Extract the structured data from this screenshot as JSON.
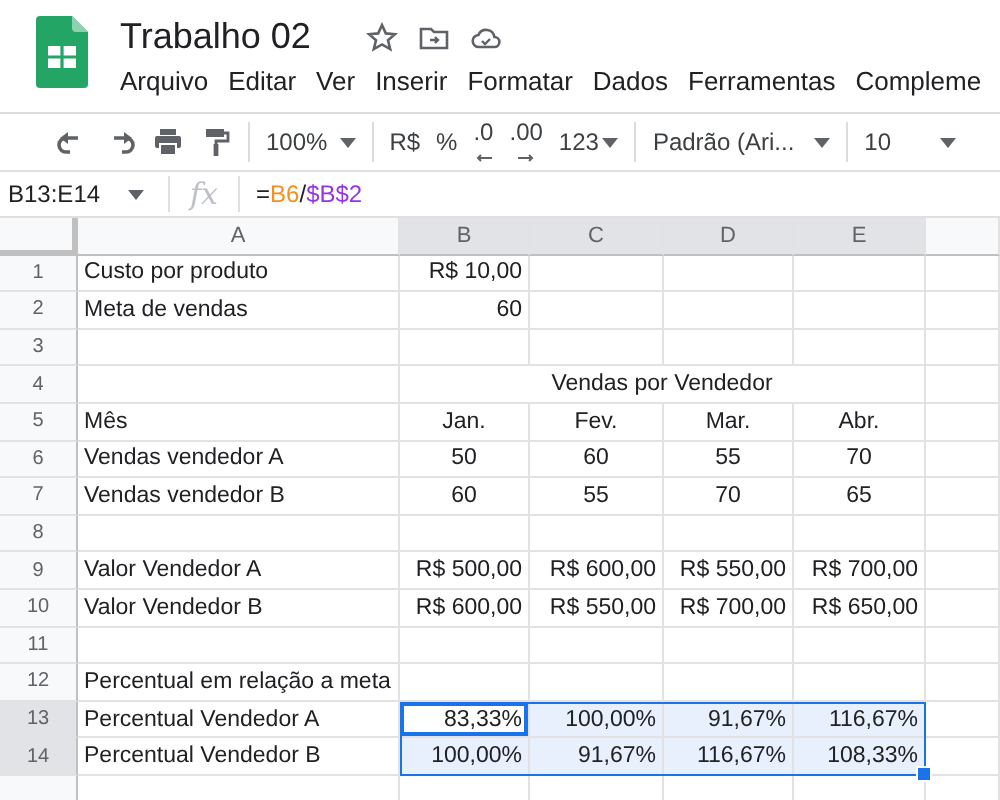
{
  "document": {
    "title": "Trabalho 02"
  },
  "menu": [
    "Arquivo",
    "Editar",
    "Ver",
    "Inserir",
    "Formatar",
    "Dados",
    "Ferramentas",
    "Compleme"
  ],
  "toolbar": {
    "zoom": "100%",
    "currency": "R$",
    "percent": "%",
    "decrease_decimals": ".0",
    "increase_decimals": ".00",
    "more_formats": "123",
    "font": "Padrão (Ari...",
    "font_size": "10"
  },
  "formula_bar": {
    "name_box": "B13:E14",
    "fx": "fx",
    "formula": [
      {
        "text": "=",
        "color": "#202124"
      },
      {
        "text": "B6",
        "color": "#f4901f"
      },
      {
        "text": "/",
        "color": "#202124"
      },
      {
        "text": "$B$2",
        "color": "#9334e6"
      }
    ]
  },
  "columns": [
    {
      "label": "A",
      "selected": false
    },
    {
      "label": "B",
      "selected": true
    },
    {
      "label": "C",
      "selected": true
    },
    {
      "label": "D",
      "selected": true
    },
    {
      "label": "E",
      "selected": true
    }
  ],
  "rows": [
    {
      "num": "1",
      "kind": "setting",
      "selected": false,
      "cells": {
        "A": {
          "text": "Custo por produto",
          "active": false
        },
        "B": {
          "text": "R$ 10,00",
          "active": false
        }
      }
    },
    {
      "num": "2",
      "kind": "setting",
      "selected": false,
      "cells": {
        "A": {
          "text": "Meta de vendas",
          "active": false
        },
        "B": {
          "text": "60",
          "active": false
        }
      }
    },
    {
      "num": "3",
      "kind": "blank",
      "selected": false,
      "cells": {}
    },
    {
      "num": "4",
      "kind": "title",
      "selected": false,
      "cells": {
        "B": {
          "text": "Vendas por Vendedor",
          "active": false
        }
      }
    },
    {
      "num": "5",
      "kind": "count",
      "selected": false,
      "cells": {
        "A": {
          "text": "Mês",
          "active": false
        },
        "B": {
          "text": "Jan.",
          "active": false
        },
        "C": {
          "text": "Fev.",
          "active": false
        },
        "D": {
          "text": "Mar.",
          "active": false
        },
        "E": {
          "text": "Abr.",
          "active": false
        }
      }
    },
    {
      "num": "6",
      "kind": "count",
      "selected": false,
      "cells": {
        "A": {
          "text": "Vendas vendedor A",
          "active": false
        },
        "B": {
          "text": "50",
          "active": false
        },
        "C": {
          "text": "60",
          "active": false
        },
        "D": {
          "text": "55",
          "active": false
        },
        "E": {
          "text": "70",
          "active": false
        }
      }
    },
    {
      "num": "7",
      "kind": "count",
      "selected": false,
      "cells": {
        "A": {
          "text": "Vendas vendedor B",
          "active": false
        },
        "B": {
          "text": "60",
          "active": false
        },
        "C": {
          "text": "55",
          "active": false
        },
        "D": {
          "text": "70",
          "active": false
        },
        "E": {
          "text": "65",
          "active": false
        }
      }
    },
    {
      "num": "8",
      "kind": "blank",
      "selected": false,
      "cells": {}
    },
    {
      "num": "9",
      "kind": "amount",
      "selected": false,
      "cells": {
        "A": {
          "text": "Valor Vendedor A",
          "active": false
        },
        "B": {
          "text": "R$ 500,00",
          "active": false
        },
        "C": {
          "text": "R$ 600,00",
          "active": false
        },
        "D": {
          "text": "R$ 550,00",
          "active": false
        },
        "E": {
          "text": "R$ 700,00",
          "active": false
        }
      }
    },
    {
      "num": "10",
      "kind": "amount",
      "selected": false,
      "cells": {
        "A": {
          "text": "Valor Vendedor B",
          "active": false
        },
        "B": {
          "text": "R$ 600,00",
          "active": false
        },
        "C": {
          "text": "R$ 550,00",
          "active": false
        },
        "D": {
          "text": "R$ 700,00",
          "active": false
        },
        "E": {
          "text": "R$ 650,00",
          "active": false
        }
      }
    },
    {
      "num": "11",
      "kind": "blank",
      "selected": false,
      "cells": {}
    },
    {
      "num": "12",
      "kind": "amount",
      "selected": false,
      "cells": {
        "A": {
          "text": "Percentual em relação a meta",
          "active": false
        }
      }
    },
    {
      "num": "13",
      "kind": "amount",
      "selected": true,
      "cells": {
        "A": {
          "text": "Percentual Vendedor A",
          "active": false
        },
        "B": {
          "text": "83,33%",
          "active": true
        },
        "C": {
          "text": "100,00%",
          "active": false
        },
        "D": {
          "text": "91,67%",
          "active": false
        },
        "E": {
          "text": "116,67%",
          "active": false
        }
      }
    },
    {
      "num": "14",
      "kind": "amount",
      "selected": true,
      "cells": {
        "A": {
          "text": "Percentual Vendedor B",
          "active": false
        },
        "B": {
          "text": "100,00%",
          "active": false
        },
        "C": {
          "text": "91,67%",
          "active": false
        },
        "D": {
          "text": "116,67%",
          "active": false
        },
        "E": {
          "text": "108,33%",
          "active": false
        }
      }
    }
  ]
}
